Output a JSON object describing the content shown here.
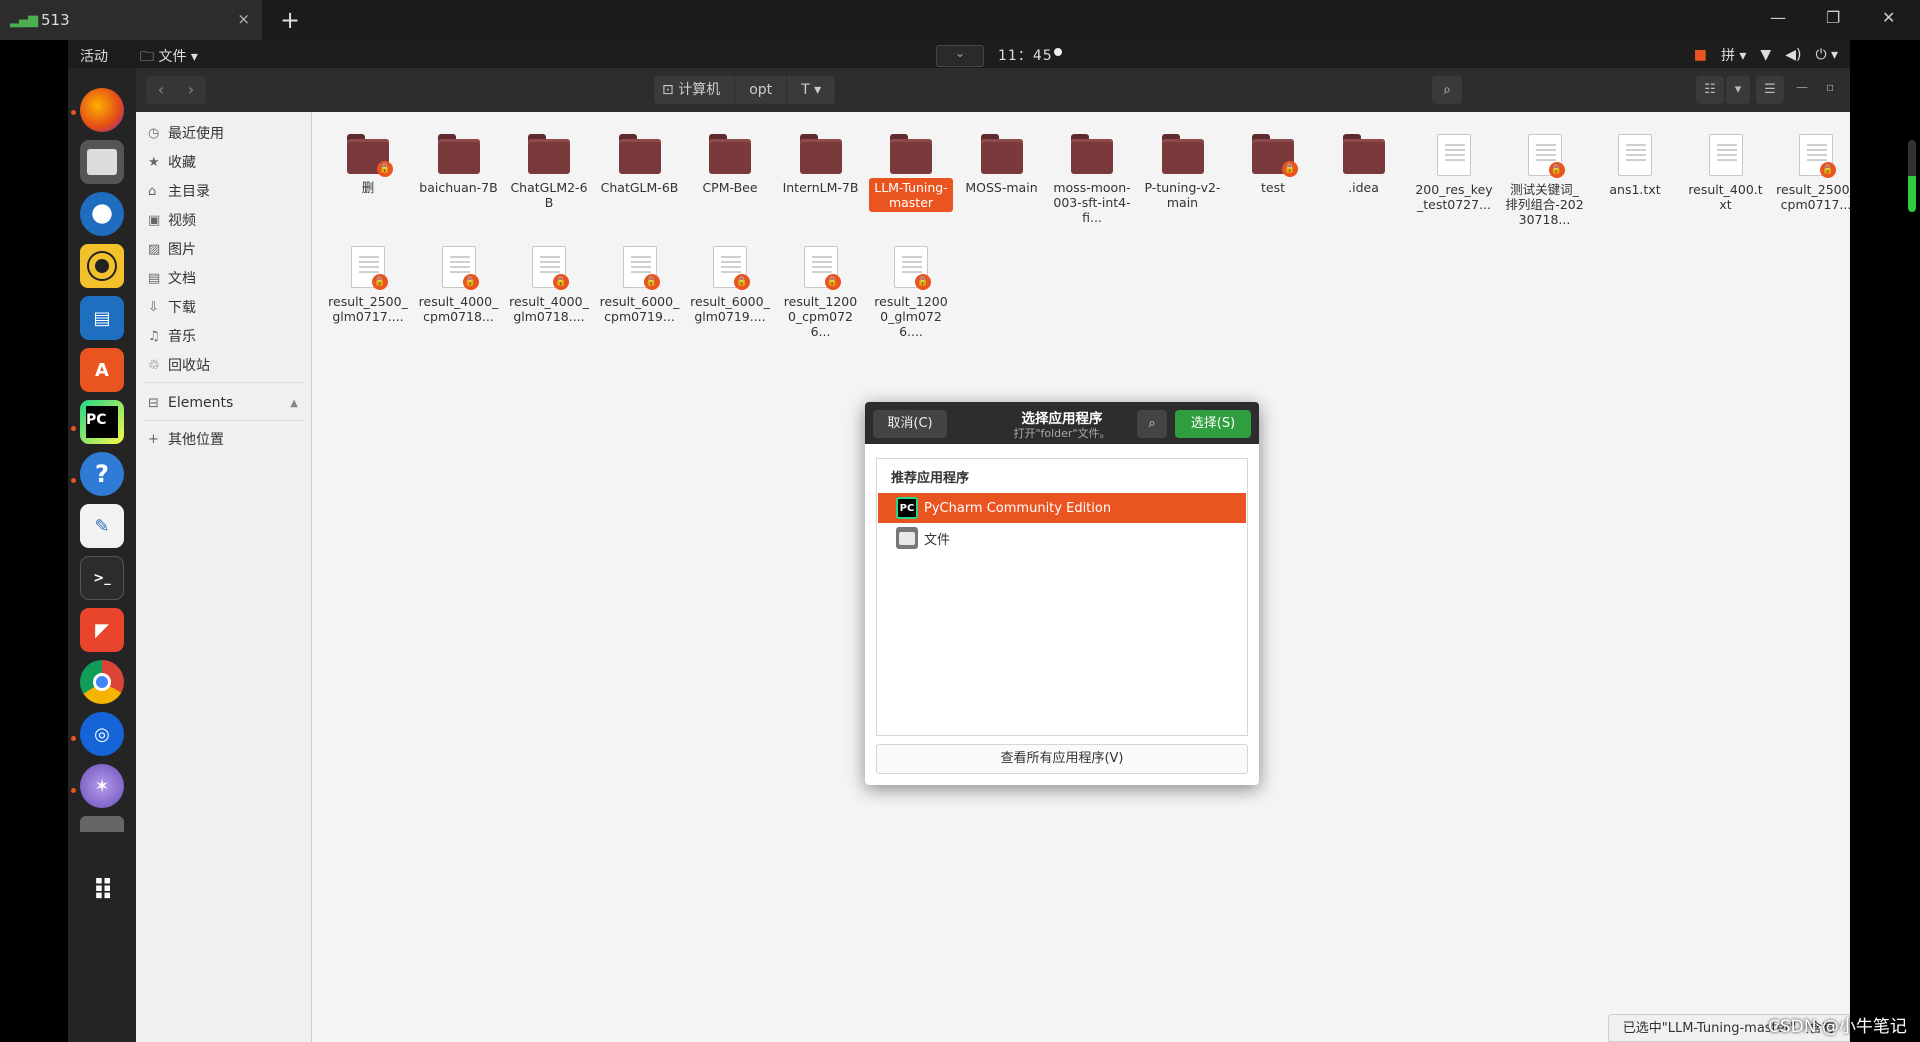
{
  "outer": {
    "tab_label": "513",
    "tab_close": "×",
    "new_tab": "+",
    "minimize": "—",
    "restore": "❐",
    "close": "✕"
  },
  "topbar": {
    "activities": "活动",
    "files_menu": "文件",
    "clock": "11：45"
  },
  "header": {
    "back": "‹",
    "forward": "›",
    "breadcrumbs": [
      "计算机",
      "opt",
      "T"
    ]
  },
  "sidebar": {
    "items": [
      {
        "icon": "clock-icon",
        "glyph": "◷",
        "label": "最近使用"
      },
      {
        "icon": "star-icon",
        "glyph": "★",
        "label": "收藏"
      },
      {
        "icon": "home-icon",
        "glyph": "⌂",
        "label": "主目录"
      },
      {
        "icon": "video-icon",
        "glyph": "▣",
        "label": "视频"
      },
      {
        "icon": "picture-icon",
        "glyph": "▨",
        "label": "图片"
      },
      {
        "icon": "document-icon",
        "glyph": "▤",
        "label": "文档"
      },
      {
        "icon": "download-icon",
        "glyph": "⇩",
        "label": "下载"
      },
      {
        "icon": "music-icon",
        "glyph": "♫",
        "label": "音乐"
      },
      {
        "icon": "trash-icon",
        "glyph": "♲",
        "label": "回收站"
      }
    ],
    "device": {
      "label": "Elements",
      "eject": "▲"
    },
    "other": {
      "label": "其他位置",
      "glyph": "+"
    }
  },
  "files_row1": [
    {
      "name": "删",
      "type": "folder",
      "locked": true
    },
    {
      "name": "baichuan-7B",
      "type": "folder",
      "locked": false
    },
    {
      "name": "ChatGLM2-6B",
      "type": "folder",
      "locked": false
    },
    {
      "name": "ChatGLM-6B",
      "type": "folder",
      "locked": false
    },
    {
      "name": "CPM-Bee",
      "type": "folder",
      "locked": false
    },
    {
      "name": "InternLM-7B",
      "type": "folder",
      "locked": false
    },
    {
      "name": "LLM-Tuning-master",
      "type": "folder",
      "locked": false,
      "selected": true
    },
    {
      "name": "MOSS-main",
      "type": "folder",
      "locked": false
    },
    {
      "name": "moss-moon-003-sft-int4-fi...",
      "type": "folder",
      "locked": false
    },
    {
      "name": "P-tuning-v2-main",
      "type": "folder",
      "locked": false
    },
    {
      "name": "test",
      "type": "folder",
      "locked": true
    },
    {
      "name": ".idea",
      "type": "folder",
      "locked": false
    },
    {
      "name": "200_res_key_test0727...",
      "type": "doc",
      "locked": false
    },
    {
      "name": "测试关键词_排列组合-20230718...",
      "type": "doc",
      "locked": true
    },
    {
      "name": "ans1.txt",
      "type": "doc",
      "locked": false
    },
    {
      "name": "result_400.txt",
      "type": "doc",
      "locked": false
    },
    {
      "name": "result_2500_cpm0717...",
      "type": "doc",
      "locked": true
    }
  ],
  "files_row2": [
    {
      "name": "result_2500_glm0717....",
      "type": "doc",
      "locked": true
    },
    {
      "name": "result_4000_cpm0718...",
      "type": "doc",
      "locked": true
    },
    {
      "name": "result_4000_glm0718....",
      "type": "doc",
      "locked": true
    },
    {
      "name": "result_6000_cpm0719...",
      "type": "doc",
      "locked": true
    },
    {
      "name": "result_6000_glm0719....",
      "type": "doc",
      "locked": true
    },
    {
      "name": "result_12000_cpm0726...",
      "type": "doc",
      "locked": true
    },
    {
      "name": "result_12000_glm0726....",
      "type": "doc",
      "locked": true
    }
  ],
  "dialog": {
    "cancel": "取消(C)",
    "title": "选择应用程序",
    "subtitle": "打开\"folder\"文件。",
    "select": "选择(S)",
    "section": "推荐应用程序",
    "apps": [
      {
        "name": "PyCharm Community Edition",
        "icon": "pycharm-icon",
        "selected": true
      },
      {
        "name": "文件",
        "icon": "files-icon",
        "selected": false
      }
    ],
    "view_all": "查看所有应用程序(V)"
  },
  "status": "已选中\"LLM-Tuning-master\"（含有",
  "watermark": "CSDN @小牛笔记",
  "volume_level": 0.5,
  "colors": {
    "accent": "#e95420",
    "select_green": "#2e9e3f",
    "folder": "#7a3a3c"
  }
}
